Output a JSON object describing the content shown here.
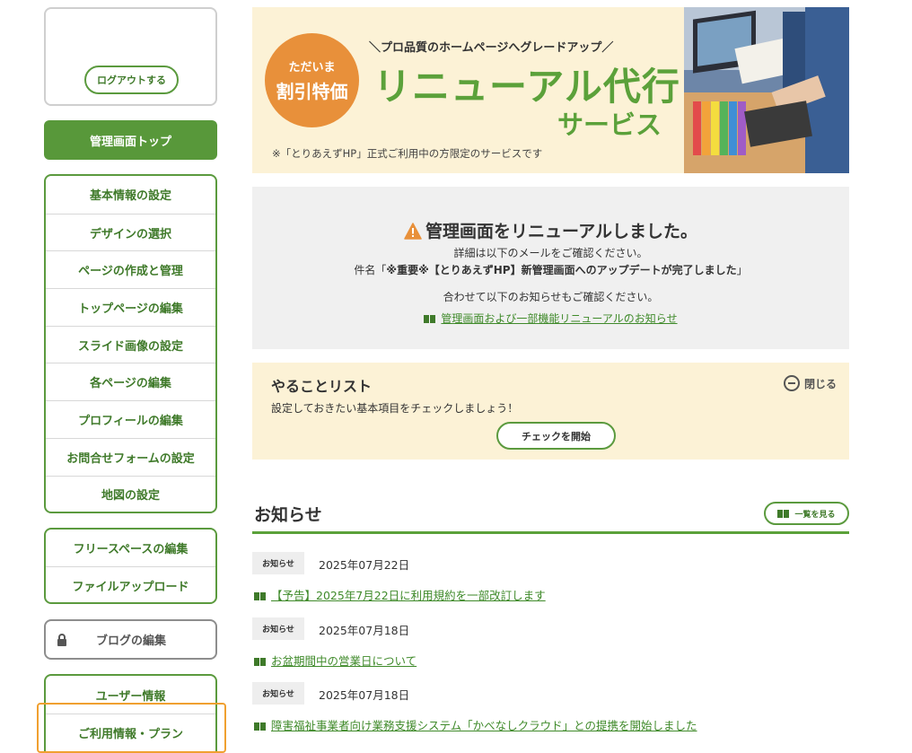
{
  "sidebar": {
    "logout_label": "ログアウトする",
    "admin_top_label": "管理画面トップ",
    "group1": [
      "基本情報の設定",
      "デザインの選択",
      "ページの作成と管理",
      "トップページの編集",
      "スライド画像の設定",
      "各ページの編集",
      "プロフィールの編集",
      "お問合せフォームの設定",
      "地図の設定"
    ],
    "group2": [
      "フリースペースの編集",
      "ファイルアップロード"
    ],
    "blog_label": "ブログの編集",
    "group3": [
      "ユーザー情報",
      "ご利用情報・プラン"
    ]
  },
  "banner": {
    "badge_line1": "ただいま",
    "badge_line2": "割引特価",
    "tagline": "＼プロ品質のホームページへグレードアップ／",
    "title1": "リニューアル代行",
    "title2": "サービス",
    "note": "※「とりあえずHP」正式ご利用中の方限定のサービスです"
  },
  "notice": {
    "title": "管理画面をリニューアルしました。",
    "line1": "詳細は以下のメールをご確認ください。",
    "line2_prefix": "件名「",
    "line2_bold": "※重要※【とりあえずHP】新管理画面へのアップデートが完了しました",
    "line2_suffix": "」",
    "line3": "合わせて以下のお知らせもご確認ください。",
    "link": "管理画面および一部機能リニューアルのお知らせ"
  },
  "todo": {
    "title": "やることリスト",
    "close_label": "閉じる",
    "description": "設定しておきたい基本項目をチェックしましょう！",
    "start_button": "チェックを開始"
  },
  "news": {
    "heading": "お知らせ",
    "view_all": "一覧を見る",
    "items": [
      {
        "tag": "お知らせ",
        "date": "2025年07月22日",
        "title": "【予告】2025年7月22日に利用規約を一部改訂します"
      },
      {
        "tag": "お知らせ",
        "date": "2025年07月18日",
        "title": "お盆期間中の営業日について"
      },
      {
        "tag": "お知らせ",
        "date": "2025年07月18日",
        "title": "障害福祉事業者向け業務支援システム「かべなしクラウド」との提携を開始しました"
      }
    ]
  },
  "colors": {
    "brand_green": "#58983a",
    "badge_orange": "#e8903a",
    "highlight_orange": "#f0a030",
    "banner_bg": "#fcf2d6"
  }
}
